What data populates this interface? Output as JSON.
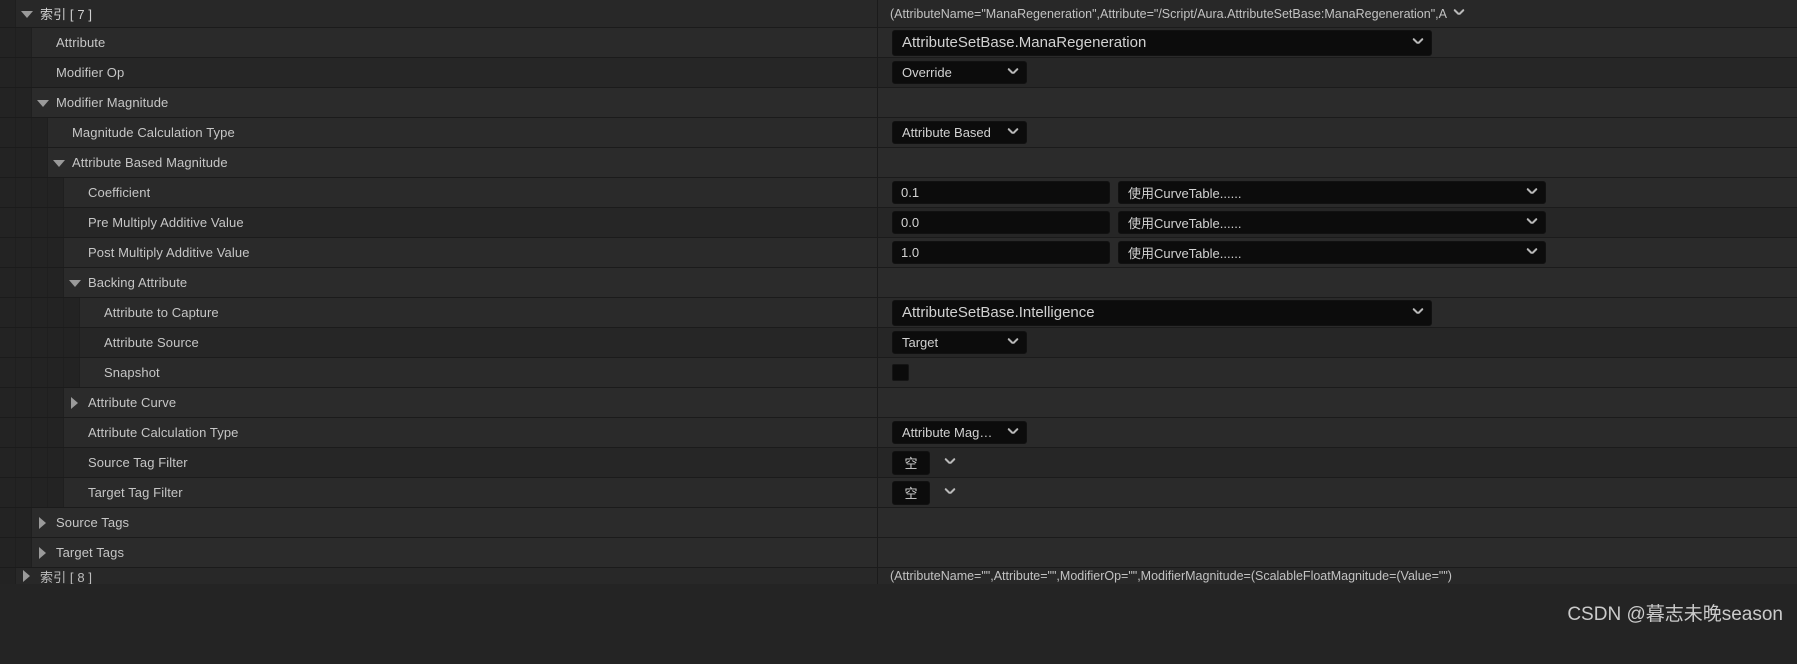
{
  "panel": {
    "watermark": "CSDN @暮志未晚season"
  },
  "index_header": {
    "label": "索引 [ 7 ]",
    "value": "(AttributeName=\"ManaRegeneration\",Attribute=\"/Script/Aura.AttributeSetBase:ManaRegeneration\",A",
    "expander": "chevron-down-icon"
  },
  "rows": [
    {
      "name": "attribute",
      "label": "Attribute",
      "widget": "combo-wide",
      "value": "AttributeSetBase.ManaRegeneration"
    },
    {
      "name": "modifier-op",
      "label": "Modifier Op",
      "widget": "combo",
      "value": "Override"
    },
    {
      "name": "modifier-magnitude",
      "label": "Modifier Magnitude",
      "widget": "none",
      "value": ""
    },
    {
      "name": "magnitude-calculation-type",
      "label": "Magnitude Calculation Type",
      "widget": "combo",
      "value": "Attribute Based"
    },
    {
      "name": "attribute-based-magnitude",
      "label": "Attribute Based Magnitude",
      "widget": "none",
      "value": ""
    },
    {
      "name": "coefficient",
      "label": "Coefficient",
      "widget": "num-curve",
      "value": "0.1",
      "curve": "使用CurveTable......"
    },
    {
      "name": "pre-multiply-additive-value",
      "label": "Pre Multiply Additive Value",
      "widget": "num-curve",
      "value": "0.0",
      "curve": "使用CurveTable......"
    },
    {
      "name": "post-multiply-additive-value",
      "label": "Post Multiply Additive Value",
      "widget": "num-curve",
      "value": "1.0",
      "curve": "使用CurveTable......"
    },
    {
      "name": "backing-attribute",
      "label": "Backing Attribute",
      "widget": "none",
      "value": ""
    },
    {
      "name": "attribute-to-capture",
      "label": "Attribute to Capture",
      "widget": "combo-wide",
      "value": "AttributeSetBase.Intelligence"
    },
    {
      "name": "attribute-source",
      "label": "Attribute Source",
      "widget": "combo",
      "value": "Target"
    },
    {
      "name": "snapshot",
      "label": "Snapshot",
      "widget": "checkbox",
      "value": ""
    },
    {
      "name": "attribute-curve",
      "label": "Attribute Curve",
      "widget": "none",
      "value": ""
    },
    {
      "name": "attribute-calculation-type",
      "label": "Attribute Calculation Type",
      "widget": "combo",
      "value": "Attribute Magnitude"
    },
    {
      "name": "source-tag-filter",
      "label": "Source Tag Filter",
      "widget": "tag",
      "value": "空"
    },
    {
      "name": "target-tag-filter",
      "label": "Target Tag Filter",
      "widget": "tag",
      "value": "空"
    },
    {
      "name": "source-tags",
      "label": "Source Tags",
      "widget": "none",
      "value": ""
    },
    {
      "name": "target-tags",
      "label": "Target Tags",
      "widget": "none",
      "value": ""
    }
  ],
  "next_index_header": {
    "label": "索引 [ 8 ]",
    "value": "(AttributeName=\"\",Attribute=\"\",ModifierOp=\"\",ModifierMagnitude=(ScalableFloatMagnitude=(Value=\"\")"
  }
}
